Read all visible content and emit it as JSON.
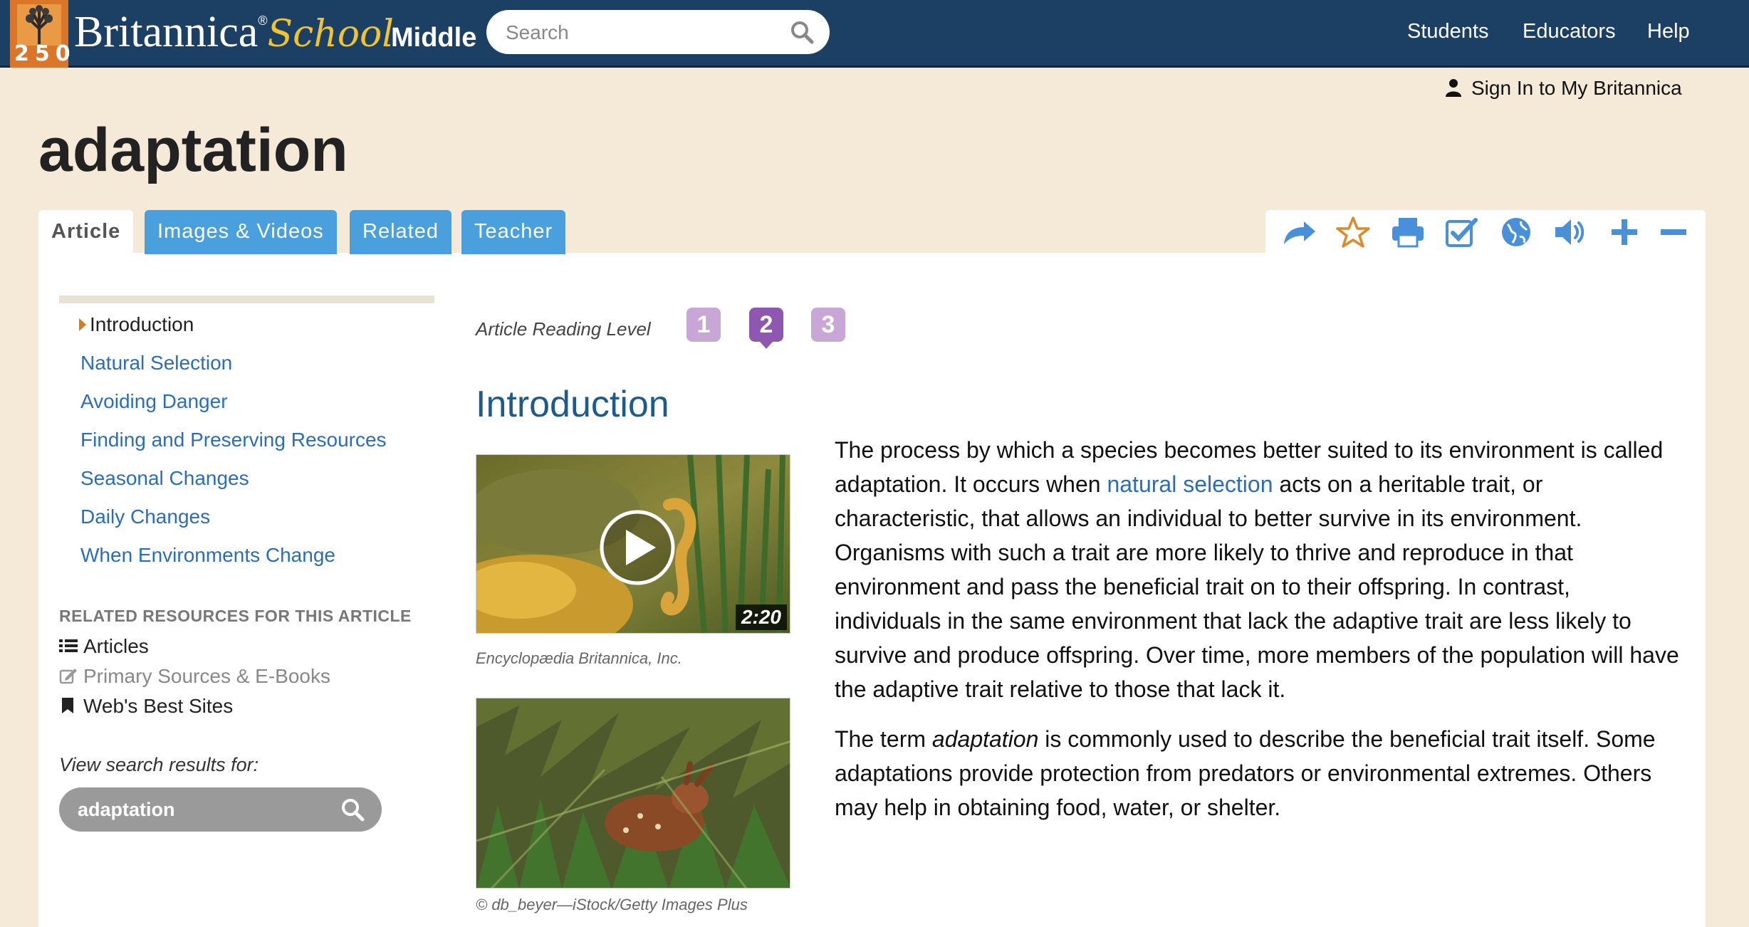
{
  "header": {
    "logo_number": "250",
    "brand_name": "Britannica",
    "brand_reg": "®",
    "brand_product": "School",
    "level": "Middle",
    "search_placeholder": "Search",
    "nav": [
      "Students",
      "Educators",
      "Help"
    ],
    "signin": "Sign In to My Britannica",
    "colors": {
      "bar": "#1c3f64",
      "badge": "#d9762a",
      "accent": "#f1c232"
    }
  },
  "page": {
    "title": "adaptation",
    "tabs": [
      "Article",
      "Images & Videos",
      "Related",
      "Teacher"
    ],
    "toolbar_icons": [
      "share-icon",
      "favorite-star-icon",
      "print-icon",
      "cite-checkbox-icon",
      "translate-globe-icon",
      "read-aloud-speaker-icon",
      "increase-font-icon",
      "decrease-font-icon"
    ]
  },
  "sidebar": {
    "toc": [
      "Introduction",
      "Natural Selection",
      "Avoiding Danger",
      "Finding and Preserving Resources",
      "Seasonal Changes",
      "Daily Changes",
      "When Environments Change"
    ],
    "related_heading": "RELATED RESOURCES FOR THIS ARTICLE",
    "related": [
      "Articles",
      "Primary Sources & E-Books",
      "Web's Best Sites"
    ],
    "search_label": "View search results for:",
    "search_value": "adaptation"
  },
  "article": {
    "reading_level_label": "Article Reading Level",
    "reading_levels": [
      "1",
      "2",
      "3"
    ],
    "current_level": "2",
    "section_title": "Introduction",
    "video_duration": "2:20",
    "video_caption": "Encyclopædia Britannica, Inc.",
    "image_caption": "© db_beyer—iStock/Getty Images Plus",
    "p1_before": "The process by which a species becomes better suited to its environment is called adaptation. It occurs when ",
    "p1_link": "natural selection",
    "p1_after": " acts on a heritable trait, or characteristic, that allows an individual to better survive in its environment. Organisms with such a trait are more likely to thrive and reproduce in that environment and pass the beneficial trait on to their offspring. In contrast, individuals in the same environment that lack the adaptive trait are less likely to survive and produce offspring. Over time, more members of the population will have the adaptive trait relative to those that lack it.",
    "p2_before": "The term ",
    "p2_em": "adaptation",
    "p2_after": " is commonly used to describe the beneficial trait itself. Some adaptations provide protection from predators or environmental extremes. Others may help in obtaining food, water, or shelter."
  }
}
